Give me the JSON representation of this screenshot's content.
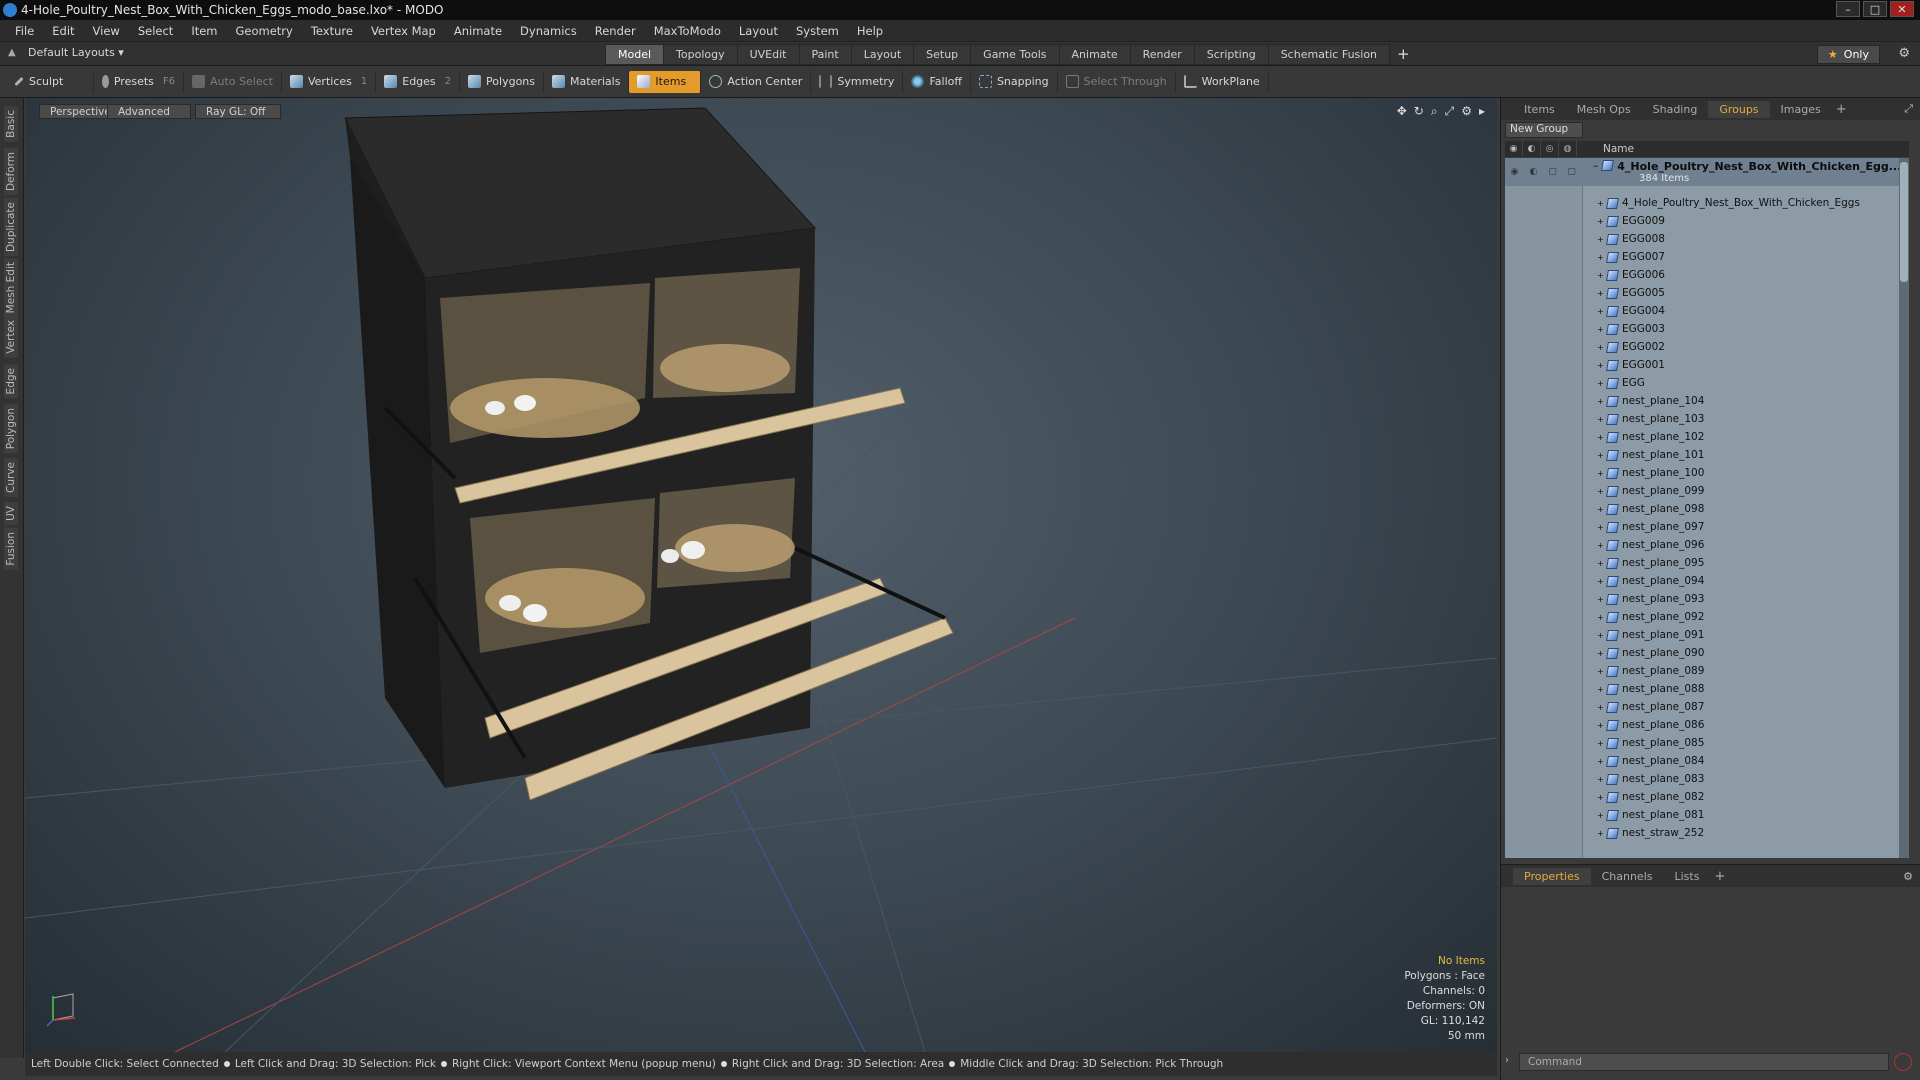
{
  "window": {
    "title": "4-Hole_Poultry_Nest_Box_With_Chicken_Eggs_modo_base.lxo* - MODO",
    "min": "–",
    "max": "□",
    "close": "✕"
  },
  "menu": [
    "File",
    "Edit",
    "View",
    "Select",
    "Item",
    "Geometry",
    "Texture",
    "Vertex Map",
    "Animate",
    "Dynamics",
    "Render",
    "MaxToModo",
    "Layout",
    "System",
    "Help"
  ],
  "layoutbar": {
    "layouts_label": "Default Layouts ▾",
    "tabs": [
      "Model",
      "Topology",
      "UVEdit",
      "Paint",
      "Layout",
      "Setup",
      "Game Tools",
      "Animate",
      "Render",
      "Scripting",
      "Schematic Fusion"
    ],
    "active_tab": "Model",
    "add": "+",
    "only_label": "Only"
  },
  "toolbar": {
    "sculpt": "Sculpt",
    "presets": "Presets",
    "presets_key": "F6",
    "auto_select": "Auto Select",
    "vertices": "Vertices",
    "vertices_num": "1",
    "edges": "Edges",
    "edges_num": "2",
    "polygons": "Polygons",
    "materials": "Materials",
    "items": "Items",
    "action_center": "Action Center",
    "symmetry": "Symmetry",
    "falloff": "Falloff",
    "snapping": "Snapping",
    "select_through": "Select Through",
    "workplane": "WorkPlane"
  },
  "lefttabs": [
    "Basic",
    "Deform",
    "Duplicate",
    "Mesh Edit",
    "Vertex",
    "Edge",
    "Polygon",
    "Curve",
    "UV",
    "Fusion"
  ],
  "viewport": {
    "view": "Perspective",
    "shading": "Advanced",
    "raygl": "Ray GL: Off",
    "info": {
      "selection": "No Items",
      "polygons": "Polygons : Face",
      "channels": "Channels: 0",
      "deformers": "Deformers: ON",
      "gl": "GL: 110,142",
      "size": "50 mm"
    }
  },
  "statusbar": [
    "Left Double Click: Select Connected",
    "Left Click and Drag: 3D Selection: Pick",
    "Right Click: Viewport Context Menu (popup menu)",
    "Right Click and Drag: 3D Selection: Area",
    "Middle Click and Drag: 3D Selection: Pick Through"
  ],
  "panel": {
    "tabs": [
      "Items",
      "Mesh Ops",
      "Shading",
      "Groups",
      "Images"
    ],
    "active_tab": "Groups",
    "new_group": "New Group",
    "name_col": "Name",
    "group_title": "4_Hole_Poultry_Nest_Box_With_Chicken_Egg...",
    "group_count": "384 Items",
    "items": [
      "4_Hole_Poultry_Nest_Box_With_Chicken_Eggs",
      "EGG009",
      "EGG008",
      "EGG007",
      "EGG006",
      "EGG005",
      "EGG004",
      "EGG003",
      "EGG002",
      "EGG001",
      "EGG",
      "nest_plane_104",
      "nest_plane_103",
      "nest_plane_102",
      "nest_plane_101",
      "nest_plane_100",
      "nest_plane_099",
      "nest_plane_098",
      "nest_plane_097",
      "nest_plane_096",
      "nest_plane_095",
      "nest_plane_094",
      "nest_plane_093",
      "nest_plane_092",
      "nest_plane_091",
      "nest_plane_090",
      "nest_plane_089",
      "nest_plane_088",
      "nest_plane_087",
      "nest_plane_086",
      "nest_plane_085",
      "nest_plane_084",
      "nest_plane_083",
      "nest_plane_082",
      "nest_plane_081",
      "nest_straw_252"
    ],
    "bottom_tabs": [
      "Properties",
      "Channels",
      "Lists"
    ],
    "bottom_active": "Properties",
    "command_placeholder": "Command"
  },
  "colors": {
    "accent": "#e59b2a",
    "list_bg": "#8c9ba6",
    "viewport_bg": "#3c4852"
  }
}
